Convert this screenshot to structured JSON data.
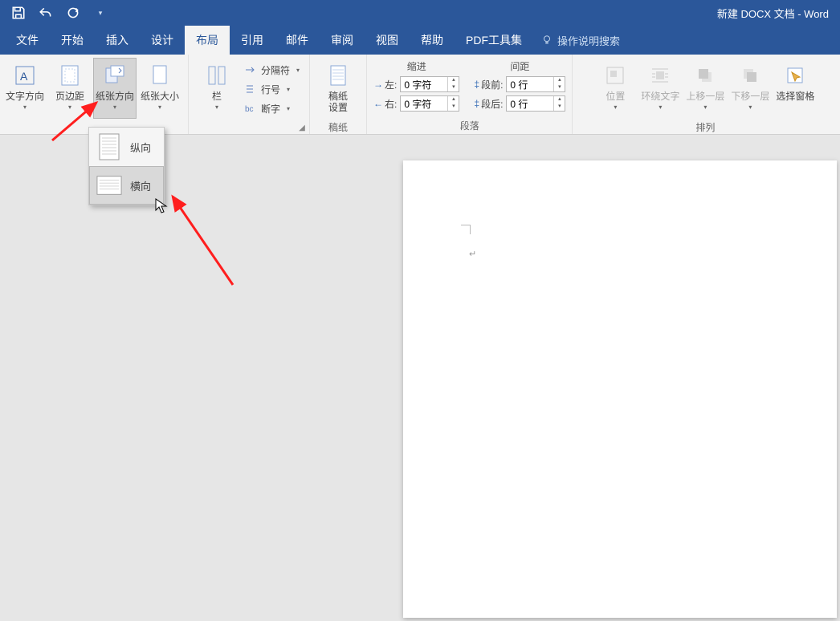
{
  "title": "新建 DOCX 文档 - Word",
  "tabs": {
    "file": "文件",
    "home": "开始",
    "insert": "插入",
    "design": "设计",
    "layout": "布局",
    "references": "引用",
    "mailings": "邮件",
    "review": "审阅",
    "view": "视图",
    "help": "帮助",
    "pdf": "PDF工具集",
    "tellme": "操作说明搜索"
  },
  "ribbon": {
    "page_setup": {
      "label": "",
      "text_direction": "文字方向",
      "margins": "页边距",
      "orientation": "纸张方向",
      "size": "纸张大小",
      "columns": "栏",
      "breaks": "分隔符",
      "line_numbers": "行号",
      "hyphenation": "断字"
    },
    "draft": {
      "button": "稿纸\n设置",
      "label": "稿纸"
    },
    "paragraph": {
      "indent_header": "缩进",
      "spacing_header": "间距",
      "left_lbl": "左:",
      "right_lbl": "右:",
      "before_lbl": "段前:",
      "after_lbl": "段后:",
      "left_val": "0 字符",
      "right_val": "0 字符",
      "before_val": "0 行",
      "after_val": "0 行",
      "label": "段落"
    },
    "arrange": {
      "position": "位置",
      "wrap": "环绕文字",
      "bring_forward": "上移一层",
      "send_backward": "下移一层",
      "selection_pane": "选择窗格",
      "label": "排列"
    }
  },
  "orientation_menu": {
    "portrait": "纵向",
    "landscape": "横向"
  }
}
